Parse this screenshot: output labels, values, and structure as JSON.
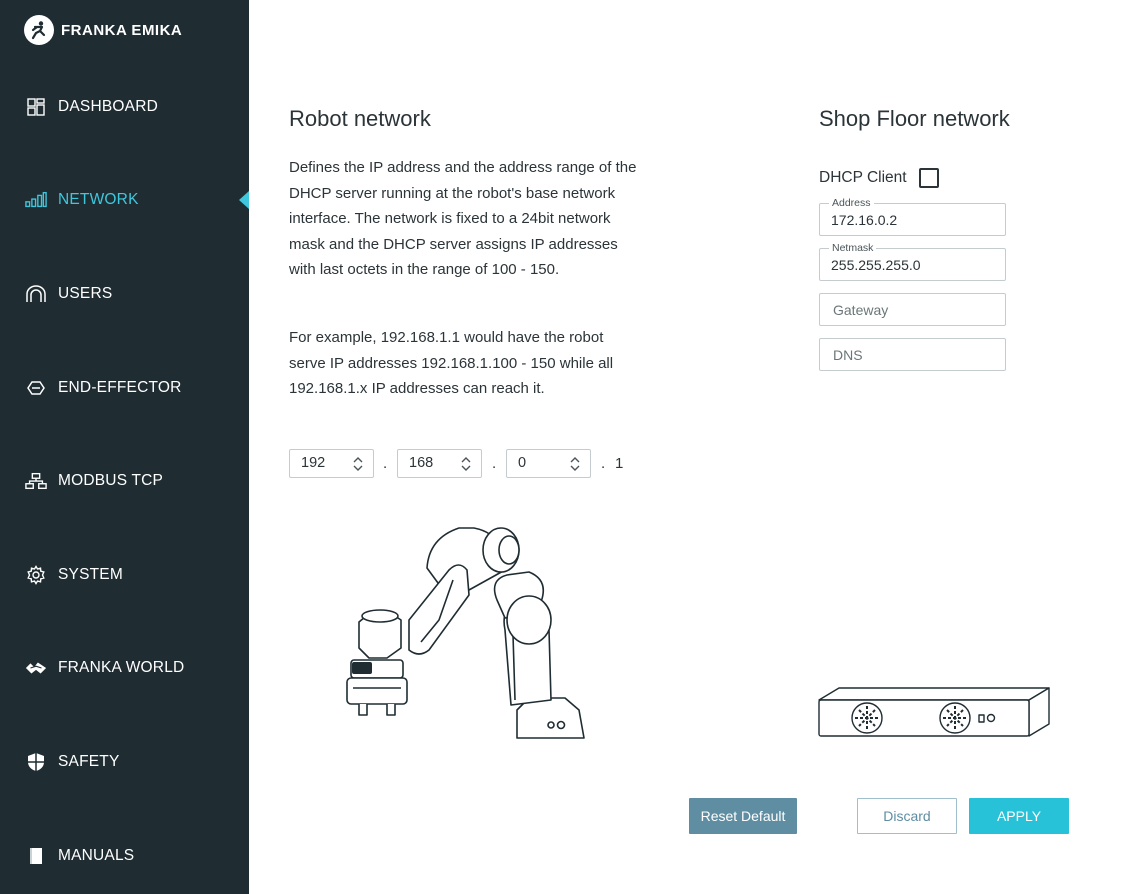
{
  "brand": {
    "name": "FRANKA EMIKA"
  },
  "sidebar": {
    "items": [
      {
        "label": "DASHBOARD",
        "icon": "dashboard-icon",
        "active": false
      },
      {
        "label": "NETWORK",
        "icon": "network-bars-icon",
        "active": true
      },
      {
        "label": "USERS",
        "icon": "users-icon",
        "active": false
      },
      {
        "label": "END-EFFECTOR",
        "icon": "end-effector-icon",
        "active": false
      },
      {
        "label": "MODBUS TCP",
        "icon": "modbus-icon",
        "active": false
      },
      {
        "label": "SYSTEM",
        "icon": "gear-icon",
        "active": false
      },
      {
        "label": "FRANKA WORLD",
        "icon": "franka-world-icon",
        "active": false
      },
      {
        "label": "SAFETY",
        "icon": "shield-icon",
        "active": false
      },
      {
        "label": "MANUALS",
        "icon": "book-icon",
        "active": false
      }
    ]
  },
  "robot_network": {
    "title": "Robot network",
    "description1": "Defines the IP address and the address range of the DHCP server running at the robot's base network interface. The network is fixed to a 24bit network mask and the DHCP server assigns IP addresses with last octets in the range of 100 - 150.",
    "description2": "For example, 192.168.1.1 would have the robot serve IP addresses 192.168.1.100 - 150 while all 192.168.1.x IP addresses can reach it.",
    "octets": [
      "192",
      "168",
      "0"
    ],
    "separator": ".",
    "last_octet": "1"
  },
  "shop_floor": {
    "title": "Shop Floor network",
    "dhcp_label": "DHCP Client",
    "dhcp_checked": false,
    "address_label": "Address",
    "address_value": "172.16.0.2",
    "netmask_label": "Netmask",
    "netmask_value": "255.255.255.0",
    "gateway_placeholder": "Gateway",
    "dns_placeholder": "DNS"
  },
  "actions": {
    "reset_label": "Reset Default",
    "discard_label": "Discard",
    "apply_label": "APPLY"
  },
  "colors": {
    "sidebar_bg": "#1f2d33",
    "accent": "#3ec7dd",
    "apply_bg": "#27c2d8",
    "reset_bg": "#5f8ea3"
  }
}
